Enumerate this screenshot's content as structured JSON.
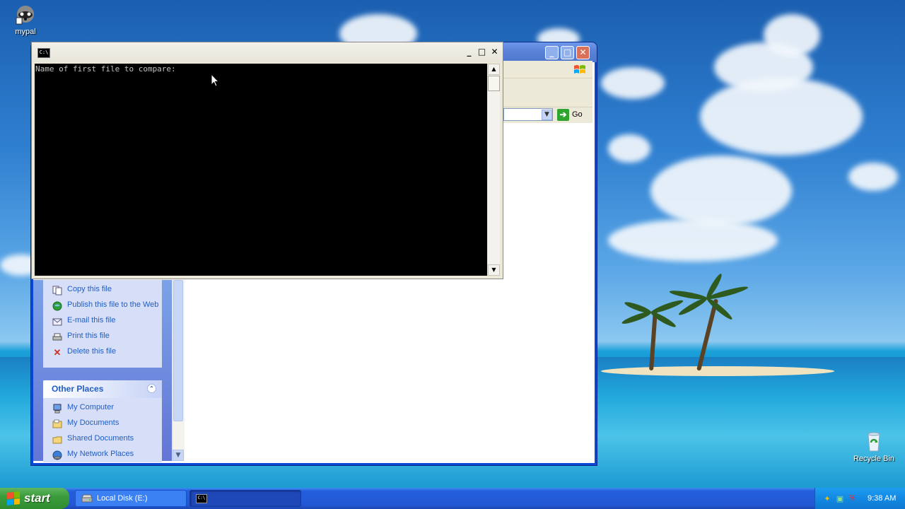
{
  "desktop": {
    "icons": [
      {
        "label": "mypal",
        "icon": "mypal-raccoon-icon"
      },
      {
        "label": "Recycle Bin",
        "icon": "recycle-bin-icon"
      }
    ]
  },
  "explorer": {
    "address_go": "Go",
    "file_tasks": [
      {
        "label": "Copy this file",
        "icon": "copy-icon"
      },
      {
        "label": "Publish this file to the Web",
        "icon": "globe-icon"
      },
      {
        "label": "E-mail this file",
        "icon": "email-icon"
      },
      {
        "label": "Print this file",
        "icon": "printer-icon"
      },
      {
        "label": "Delete this file",
        "icon": "delete-x-icon"
      }
    ],
    "other_places": {
      "title": "Other Places",
      "items": [
        {
          "label": "My Computer",
          "icon": "my-computer-icon"
        },
        {
          "label": "My Documents",
          "icon": "my-documents-icon"
        },
        {
          "label": "Shared Documents",
          "icon": "shared-folder-icon"
        },
        {
          "label": "My Network Places",
          "icon": "network-places-icon"
        }
      ]
    }
  },
  "cmd": {
    "icon_text": "C:\\",
    "console_text": "Name of first file to compare:"
  },
  "taskbar": {
    "start_label": "start",
    "buttons": [
      {
        "label": "Local Disk (E:)",
        "icon": "drive-icon"
      },
      {
        "label": "",
        "icon": "cmd-icon"
      }
    ],
    "clock": "9:38 AM"
  },
  "colors": {
    "xp_blue": "#245edb",
    "task_link": "#215dc6",
    "start_green": "#3c9c3c"
  }
}
